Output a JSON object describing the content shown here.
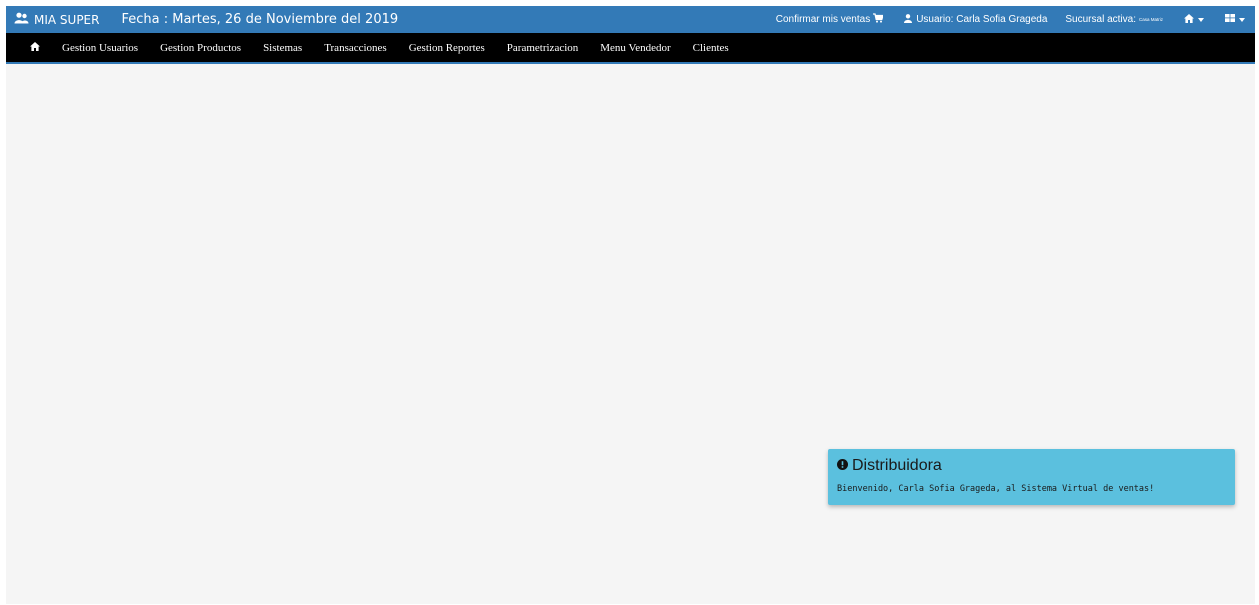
{
  "header": {
    "brand_icon": "users-icon",
    "brand": "MIA SUPER",
    "date": "Fecha : Martes, 26 de Noviembre del 2019",
    "confirm_sales": "Confirmar mis ventas",
    "confirm_icon": "cart-icon",
    "user": "Usuario: Carla Sofia Grageda",
    "user_icon": "user-icon",
    "branch_label": "Sucursal activa:",
    "branch_value": "Casa Matriz",
    "home_menu_icon": "home-icon",
    "grid_menu_icon": "grid-icon"
  },
  "nav": {
    "home_icon": "home-icon",
    "items": [
      "Gestion Usuarios",
      "Gestion Productos",
      "Sistemas",
      "Transacciones",
      "Gestion Reportes",
      "Parametrizacion",
      "Menu Vendedor",
      "Clientes"
    ]
  },
  "notification": {
    "icon": "info-circle-icon",
    "title": "Distribuidora",
    "message": "Bienvenido, Carla Sofia Grageda, al Sistema Virtual de ventas!"
  },
  "colors": {
    "topbar": "#337ab7",
    "navbar": "#000000",
    "background": "#f5f5f5",
    "notification": "#5bc0de"
  }
}
